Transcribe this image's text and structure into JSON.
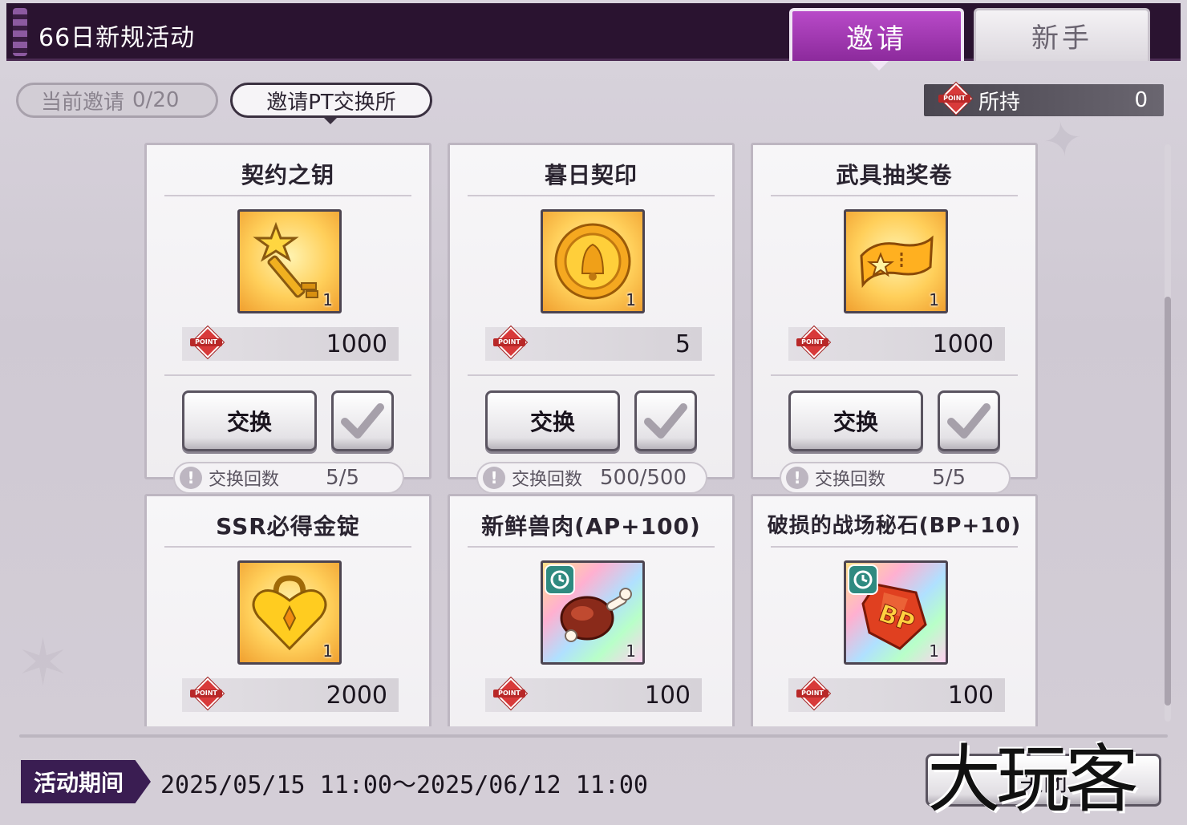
{
  "header": {
    "title": "66日新规活动",
    "tabs": [
      {
        "label": "邀请",
        "active": true
      },
      {
        "label": "新手",
        "active": false
      }
    ]
  },
  "controls": {
    "current_invite_label": "当前邀请",
    "current_invite_value": "0/20",
    "pt_exchange_label": "邀请PT交换所",
    "held_label": "所持",
    "held_value": "0"
  },
  "point_icon_text": "POINT",
  "items": [
    {
      "title": "契约之钥",
      "count": "1",
      "price": "1000",
      "exchange_label": "交换",
      "limit_label": "交换回数",
      "limit_value": "5/5",
      "icon": "golden-key-icon",
      "timed": false
    },
    {
      "title": "暮日契印",
      "count": "1",
      "price": "5",
      "exchange_label": "交换",
      "limit_label": "交换回数",
      "limit_value": "500/500",
      "icon": "golden-seal-icon",
      "timed": false
    },
    {
      "title": "武具抽奖卷",
      "count": "1",
      "price": "1000",
      "exchange_label": "交换",
      "limit_label": "交换回数",
      "limit_value": "5/5",
      "icon": "ticket-icon",
      "timed": false
    },
    {
      "title": "SSR必得金锭",
      "count": "1",
      "price": "2000",
      "icon": "heart-lock-icon",
      "timed": false
    },
    {
      "title": "新鲜兽肉(AP+100)",
      "count": "1",
      "price": "100",
      "icon": "meat-icon",
      "timed": true
    },
    {
      "title": "破损的战场秘石(BP+10)",
      "count": "1",
      "price": "100",
      "icon": "bp-stone-icon",
      "timed": true
    }
  ],
  "footer": {
    "period_label": "活动期间",
    "period_value": "2025/05/15 11:00～2025/06/12 11:00",
    "close_label": "关闭"
  },
  "watermark": "大玩客",
  "colors": {
    "header_bg": "#2a1330",
    "tab_active": "#a43ab8",
    "point_red": "#d83a3a",
    "period_bg": "#3a1d52"
  }
}
